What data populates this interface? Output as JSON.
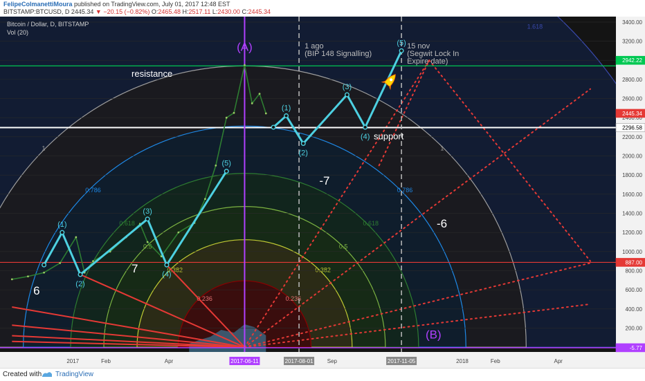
{
  "header": {
    "author": "FelipeColmanettiMoura",
    "published": "published on TradingView.com, July 01, 2017 12:48 EST",
    "symbol": "BITSTAMP:BTCUSD, D",
    "price": "2445.34",
    "change": "▼ −20.15 (−0.82%)",
    "ohlc_o_label": "O:",
    "ohlc_o": "2465.48",
    "ohlc_h_label": "H:",
    "ohlc_h": "2517.11",
    "ohlc_l_label": "L:",
    "ohlc_l": "2430.00",
    "ohlc_c_label": "C:",
    "ohlc_c": "2445.34"
  },
  "footer": {
    "created": "Created with",
    "brand": "TradingView"
  },
  "colors": {
    "background": "#141414",
    "price_line": "#2e7d32",
    "wave": "#4dd0e1",
    "fan": "#e53935",
    "purple": "#b040ff",
    "resistance": "#00c853",
    "support": "#ffffff",
    "marker_887": "#e53935"
  },
  "chart_data": {
    "type": "line",
    "title": "Bitcoin / Dollar, D, BITSTAMP",
    "subtitle": "Vol (20)",
    "xlabel": "",
    "ylabel": "",
    "ylim": [
      -50,
      3450
    ],
    "y_ticks": [
      200,
      400,
      600,
      800,
      1000,
      1200,
      1400,
      1600,
      1800,
      2000,
      2200,
      2400,
      2600,
      2800,
      3000,
      3200,
      3400
    ],
    "x_ticks": [
      {
        "label": "2017",
        "date": "2017-01-01"
      },
      {
        "label": "Feb",
        "date": "2017-02-01"
      },
      {
        "label": "Apr",
        "date": "2017-04-01"
      },
      {
        "label": "Sep",
        "date": "2017-09-01"
      },
      {
        "label": "2018",
        "date": "2018-01-01"
      },
      {
        "label": "Feb",
        "date": "2018-02-01"
      },
      {
        "label": "Apr",
        "date": "2018-04-01"
      }
    ],
    "x_highlight_labels": [
      {
        "label": "2017-06-11",
        "date": "2017-06-11"
      },
      {
        "label": "2017-08-01",
        "date": "2017-08-01"
      },
      {
        "label": "2017-11-05",
        "date": "2017-11-05"
      }
    ],
    "price_series": {
      "x": [
        "2016-11-05",
        "2016-11-20",
        "2016-12-05",
        "2016-12-20",
        "2017-01-04",
        "2017-01-12",
        "2017-01-20",
        "2017-02-05",
        "2017-02-20",
        "2017-03-05",
        "2017-03-12",
        "2017-03-25",
        "2017-04-10",
        "2017-04-25",
        "2017-05-05",
        "2017-05-15",
        "2017-05-25",
        "2017-06-01",
        "2017-06-11",
        "2017-06-18",
        "2017-06-25",
        "2017-07-01"
      ],
      "y": [
        710,
        740,
        780,
        880,
        1150,
        780,
        900,
        1000,
        1150,
        1290,
        1100,
        950,
        1200,
        1300,
        1550,
        1900,
        2400,
        2450,
        2950,
        2550,
        2650,
        2445
      ]
    },
    "price_labels": [
      {
        "value": 3000,
        "label": "2942.22",
        "color": "#00c853"
      },
      {
        "value": 2445.34,
        "label": "2445.34",
        "color": "#e53935"
      },
      {
        "value": 2296.58,
        "label": "2296.58",
        "color": "#ffffff"
      },
      {
        "value": 887,
        "label": "887.00",
        "color": "#e53935"
      },
      {
        "value": -5.77,
        "label": "-5.77",
        "color": "#b040ff"
      }
    ],
    "horizontal_lines": [
      {
        "name": "resistance",
        "value": 2942.22,
        "label": "resistance",
        "label_date": "2017-02-25"
      },
      {
        "name": "support",
        "value": 2296.58,
        "label": "support",
        "label_date": "2017-10-10"
      },
      {
        "name": "level-887",
        "value": 887,
        "label": ""
      }
    ],
    "vertical_lines": [
      {
        "name": "wave-a-line",
        "date": "2017-06-11",
        "style": "solid"
      },
      {
        "name": "bip148-line",
        "date": "2017-08-01",
        "style": "dashed",
        "text1": "1 ago",
        "text2": "(BIP 148 Signalling)"
      },
      {
        "name": "segwit-line",
        "date": "2017-11-05",
        "style": "dashed",
        "text1": "15 nov",
        "text2": "(Segwit Lock In",
        "text3": "Expire date)"
      }
    ],
    "wave_points_past": [
      {
        "date": "2016-12-05",
        "value": 860,
        "label": ""
      },
      {
        "date": "2016-12-22",
        "value": 1200,
        "label": "(1)"
      },
      {
        "date": "2017-01-08",
        "value": 760,
        "label": "(2)"
      },
      {
        "date": "2017-03-12",
        "value": 1340,
        "label": "(3)"
      },
      {
        "date": "2017-03-30",
        "value": 860,
        "label": "(4)"
      },
      {
        "date": "2017-05-25",
        "value": 1840,
        "label": "(5)"
      }
    ],
    "wave_points_future": [
      {
        "date": "2017-07-08",
        "value": 2300,
        "label": ""
      },
      {
        "date": "2017-07-20",
        "value": 2420,
        "label": "(1)"
      },
      {
        "date": "2017-08-05",
        "value": 2130,
        "label": "(2)"
      },
      {
        "date": "2017-09-15",
        "value": 2640,
        "label": "(3)"
      },
      {
        "date": "2017-10-02",
        "value": 2300,
        "label": "(4)"
      },
      {
        "date": "2017-11-05",
        "value": 3100,
        "label": "(5)"
      }
    ],
    "wave_letters": [
      {
        "label": "(A)",
        "date": "2017-06-11",
        "value": 3100,
        "color": "#b040ff"
      },
      {
        "label": "(B)",
        "date": "2017-12-05",
        "value": 90,
        "color": "#b040ff"
      }
    ],
    "count_labels": [
      {
        "label": "6",
        "date": "2016-11-25",
        "value": 550
      },
      {
        "label": "7",
        "date": "2017-02-25",
        "value": 780
      },
      {
        "label": "-7",
        "date": "2017-08-20",
        "value": 1700
      },
      {
        "label": "-6",
        "date": "2017-12-08",
        "value": 1250
      }
    ],
    "fib_arcs": {
      "center_date": "2017-06-11",
      "center_value": 0,
      "levels": [
        {
          "ratio": 0.236,
          "label": "0.236",
          "color": "#8b0000"
        },
        {
          "ratio": 0.382,
          "label": "0.382",
          "color": "#c0ca33"
        },
        {
          "ratio": 0.5,
          "label": "0.5",
          "color": "#7cb342"
        },
        {
          "ratio": 0.618,
          "label": "0.618",
          "color": "#2e7d32"
        },
        {
          "ratio": 0.786,
          "label": "0.786",
          "color": "#1e88e5"
        },
        {
          "ratio": 1,
          "label": "1",
          "color": "#9e9e9e"
        },
        {
          "ratio": 1.618,
          "label": "1.618",
          "color": "#3949ab"
        }
      ]
    },
    "fan_lines": [
      {
        "date": "2017-01-08",
        "value": 760
      },
      {
        "date": "2017-03-30",
        "value": 860
      },
      {
        "date": "2016-11-05",
        "value": 420
      },
      {
        "date": "2016-11-05",
        "value": 230
      },
      {
        "date": "2016-11-05",
        "value": 120
      },
      {
        "date": "2016-11-05",
        "value": 60
      }
    ],
    "fan_lines_future": [
      {
        "date": "2017-12-01",
        "value": 3000
      },
      {
        "date": "2018-05-01",
        "value": 2700
      },
      {
        "date": "2018-05-01",
        "value": 880
      },
      {
        "date": "2018-05-01",
        "value": 450
      }
    ],
    "cross_lines": [
      {
        "from_date": "2017-10-15",
        "from_value": 1900,
        "to_date": "2017-12-01",
        "to_value": 3000
      },
      {
        "from_date": "2017-12-01",
        "from_value": 3000,
        "to_date": "2018-05-01",
        "to_value": 900
      }
    ],
    "volume": {
      "x": [
        "2017-04-20",
        "2017-05-01",
        "2017-05-10",
        "2017-05-20",
        "2017-06-01",
        "2017-06-11",
        "2017-06-20",
        "2017-07-01"
      ],
      "y": [
        0.3,
        0.45,
        0.55,
        0.8,
        0.7,
        1.0,
        0.9,
        0.6
      ]
    },
    "icons": [
      {
        "name": "rocket-icon",
        "date": "2017-10-25",
        "value": 2780
      }
    ]
  }
}
